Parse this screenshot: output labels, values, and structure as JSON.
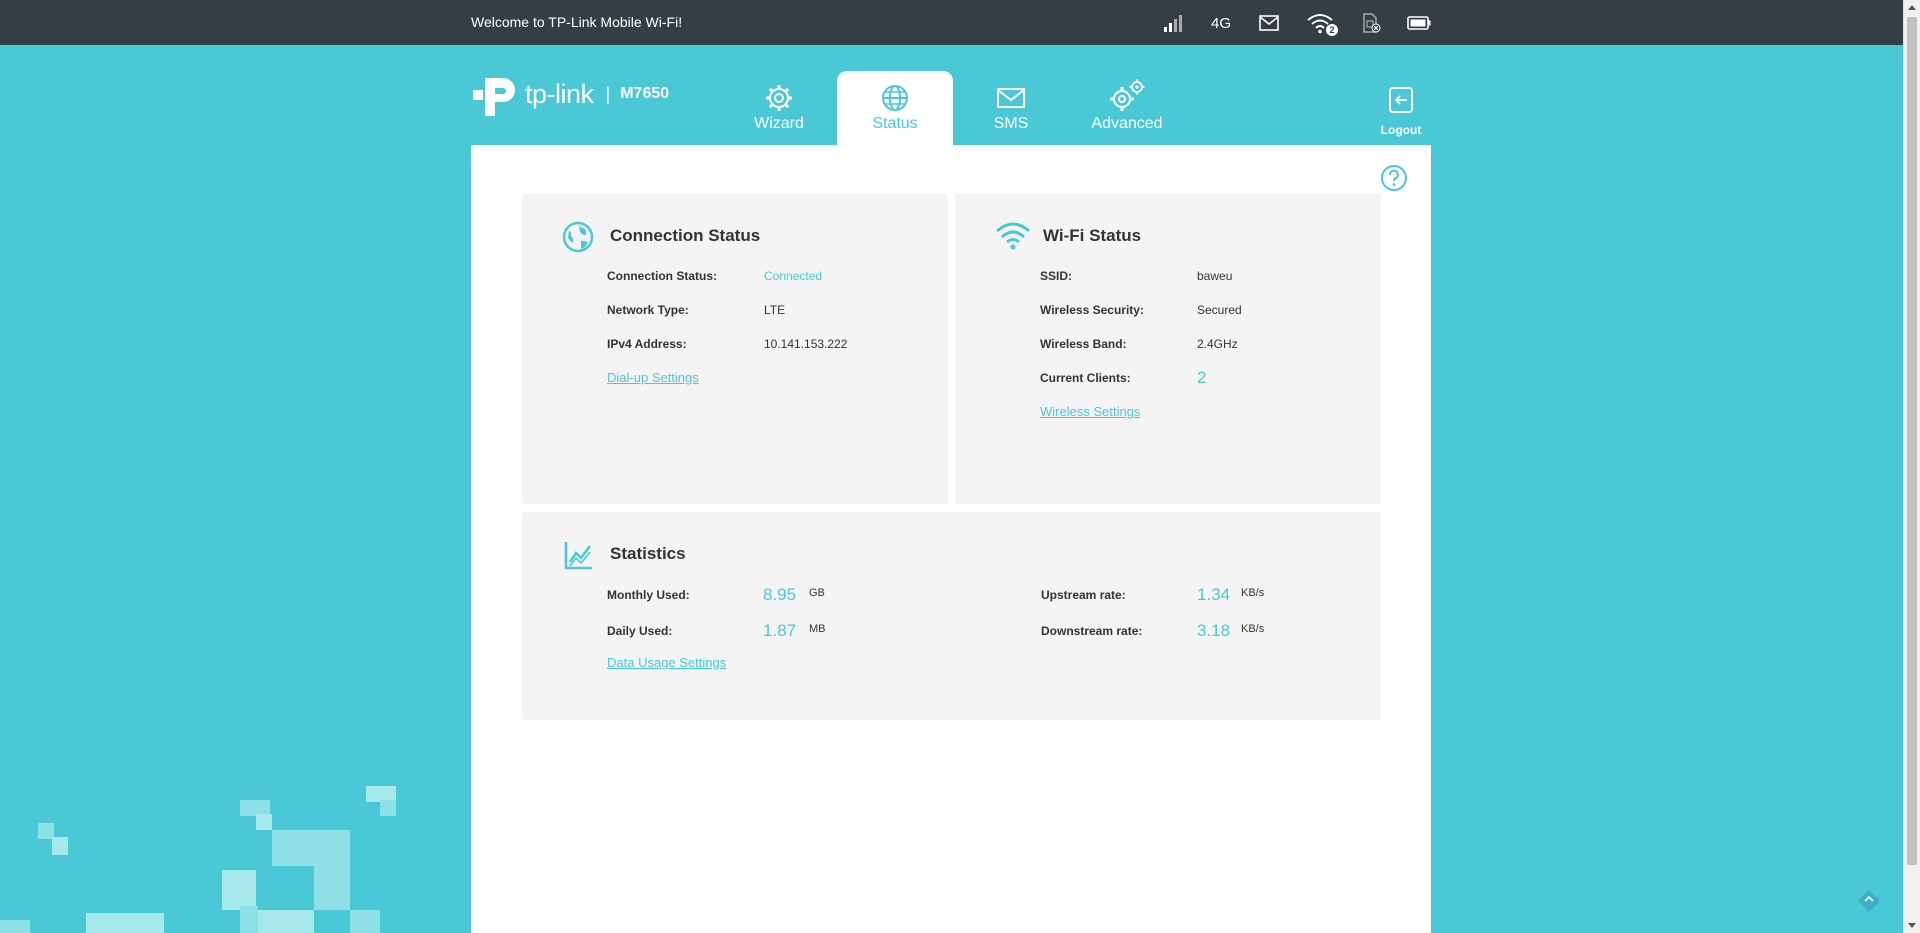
{
  "topbar": {
    "welcome": "Welcome to TP-Link Mobile Wi-Fi!",
    "network_type": "4G",
    "wifi_clients_badge": "2",
    "icons": [
      "signal-bars-icon",
      "network-type",
      "mail-icon",
      "wifi-clients-icon",
      "sim-card-icon",
      "battery-icon"
    ]
  },
  "header": {
    "brand": "tp-link",
    "model": "M7650",
    "tabs": [
      {
        "label": "Wizard",
        "icon": "gear-icon"
      },
      {
        "label": "Status",
        "icon": "globe-icon"
      },
      {
        "label": "SMS",
        "icon": "envelope-icon"
      },
      {
        "label": "Advanced",
        "icon": "double-gear-icon"
      }
    ],
    "active_tab": "Status",
    "logout_label": "Logout"
  },
  "connection": {
    "title": "Connection Status",
    "rows": [
      {
        "label": "Connection Status:",
        "value": "Connected"
      },
      {
        "label": "Network Type:",
        "value": "LTE"
      },
      {
        "label": "IPv4 Address:",
        "value": "10.141.153.222"
      }
    ],
    "link": "Dial-up Settings"
  },
  "wifi": {
    "title": "Wi-Fi Status",
    "rows": [
      {
        "label": "SSID:",
        "value": "baweu"
      },
      {
        "label": "Wireless Security:",
        "value": "Secured"
      },
      {
        "label": "Wireless Band:",
        "value": "2.4GHz"
      },
      {
        "label": "Current Clients:",
        "value": "2"
      }
    ],
    "link": "Wireless Settings"
  },
  "statistics": {
    "title": "Statistics",
    "monthly": {
      "label": "Monthly Used:",
      "value": "8.95",
      "unit": "GB"
    },
    "daily": {
      "label": "Daily Used:",
      "value": "1.87",
      "unit": "MB"
    },
    "upstream": {
      "label": "Upstream rate:",
      "value": "1.34",
      "unit": "KB/s"
    },
    "downstream": {
      "label": "Downstream rate:",
      "value": "3.18",
      "unit": "KB/s"
    },
    "link": "Data Usage Settings"
  },
  "colors": {
    "accent": "#4ac8d6",
    "topbar": "#343f45",
    "card": "#f4f4f4"
  }
}
